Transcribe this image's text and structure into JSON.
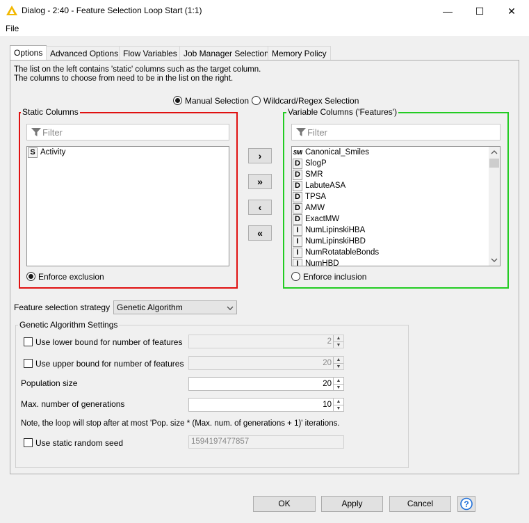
{
  "window": {
    "title": "Dialog - 2:40 - Feature Selection Loop Start (1:1)",
    "minimize_glyph": "—",
    "maximize_glyph": "☐",
    "close_glyph": "✕"
  },
  "menu": {
    "file": "File"
  },
  "tabs": [
    {
      "label": "Options"
    },
    {
      "label": "Advanced Options"
    },
    {
      "label": "Flow Variables"
    },
    {
      "label": "Job Manager Selection"
    },
    {
      "label": "Memory Policy"
    }
  ],
  "options": {
    "description_line1": "The list on the left contains 'static' columns such as the target column.",
    "description_line2": "The columns to choose from need to be in the list on the right.",
    "mode": {
      "manual_label": "Manual Selection",
      "wildcard_label": "Wildcard/Regex Selection",
      "selected": "manual"
    },
    "static": {
      "title": "Static Columns",
      "filter_placeholder": "Filter",
      "items": [
        {
          "type": "S",
          "name": "Activity"
        }
      ],
      "enforce_label": "Enforce exclusion",
      "enforce_checked": true
    },
    "variable": {
      "title": "Variable Columns ('Features')",
      "filter_placeholder": "Filter",
      "items": [
        {
          "type": "SMI",
          "name": "Canonical_Smiles"
        },
        {
          "type": "D",
          "name": "SlogP"
        },
        {
          "type": "D",
          "name": "SMR"
        },
        {
          "type": "D",
          "name": "LabuteASA"
        },
        {
          "type": "D",
          "name": "TPSA"
        },
        {
          "type": "D",
          "name": "AMW"
        },
        {
          "type": "D",
          "name": "ExactMW"
        },
        {
          "type": "I",
          "name": "NumLipinskiHBA"
        },
        {
          "type": "I",
          "name": "NumLipinskiHBD"
        },
        {
          "type": "I",
          "name": "NumRotatableBonds"
        },
        {
          "type": "I",
          "name": "NumHBD"
        }
      ],
      "enforce_label": "Enforce inclusion",
      "enforce_checked": false
    },
    "transfer_buttons": {
      "add": "›",
      "add_all": "»",
      "remove": "‹",
      "remove_all": "«"
    },
    "strategy": {
      "label": "Feature selection strategy",
      "value": "Genetic Algorithm"
    },
    "ga": {
      "title": "Genetic Algorithm Settings",
      "lower_bound": {
        "label": "Use lower bound for number of features",
        "checked": false,
        "value": "2"
      },
      "upper_bound": {
        "label": "Use upper bound for number of features",
        "checked": false,
        "value": "20"
      },
      "population": {
        "label": "Population size",
        "value": "20"
      },
      "generations": {
        "label": "Max. number of generations",
        "value": "10"
      },
      "note": "Note, the loop will stop after at most 'Pop. size * (Max. num. of generations + 1)' iterations.",
      "seed": {
        "label": "Use static random seed",
        "checked": false,
        "value": "1594197477857"
      }
    }
  },
  "footer": {
    "ok": "OK",
    "apply": "Apply",
    "cancel": "Cancel",
    "help": "?"
  },
  "colors": {
    "static_border": "#e01010",
    "variable_border": "#22cc22",
    "app_icon": "#f2b800",
    "help_icon": "#1e6fd9"
  }
}
